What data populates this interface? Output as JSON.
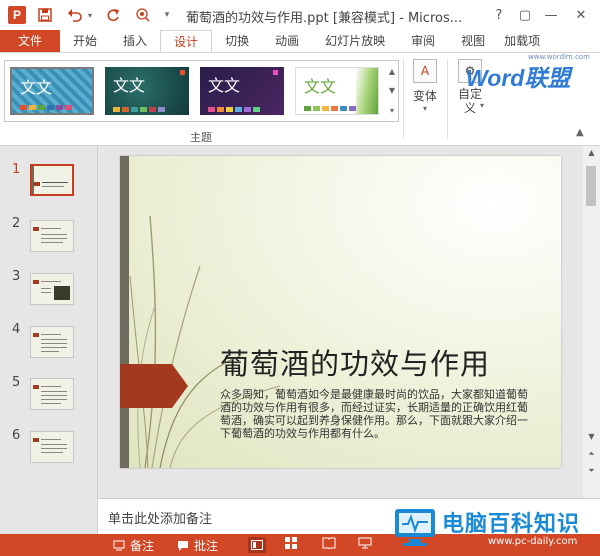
{
  "app": {
    "title": "葡萄酒的功效与作用.ppt [兼容模式] - Micros...",
    "icon_letter": "P",
    "help": "?",
    "restore": "▢",
    "minimize": "—",
    "close": "✕"
  },
  "qat": [
    "save-icon",
    "undo-icon",
    "redo-icon",
    "touch-mode-icon",
    "customize-icon"
  ],
  "tabs": {
    "file": "文件",
    "home": "开始",
    "insert": "插入",
    "design": "设计",
    "transitions": "切换",
    "animations": "动画",
    "slideshow": "幻灯片放映",
    "review": "审阅",
    "view": "视图",
    "addins": "加载项"
  },
  "ribbon": {
    "theme_label": "文文",
    "group_themes": "主题",
    "variant": "变体",
    "customize": "自定义",
    "variant_arrow": "▾",
    "customize_arrow": "▾"
  },
  "watermark_top": {
    "brand": "Word联盟",
    "url": "www.wordlm.com"
  },
  "thumbnails": [
    "1",
    "2",
    "3",
    "4",
    "5",
    "6"
  ],
  "slide": {
    "title": "葡萄酒的功效与作用",
    "body": "众多周知，葡萄酒如今是最健康最时尚的饮品，大家都知道葡萄酒的功效与作用有很多，而经过证实，长期适量的正确饮用红葡萄酒，确实可以起到养身保健作用。那么，下面就跟大家介绍一下葡萄酒的功效与作用都有什么。"
  },
  "notes": {
    "placeholder": "单击此处添加备注"
  },
  "statusbar": {
    "notes": "备注",
    "comments": "批注"
  },
  "watermark_bottom": {
    "brand": "电脑百科知识",
    "url": "www.pc-daily.com"
  },
  "colors": {
    "accent": "#d24726",
    "slide_arrow": "#a33a20"
  }
}
